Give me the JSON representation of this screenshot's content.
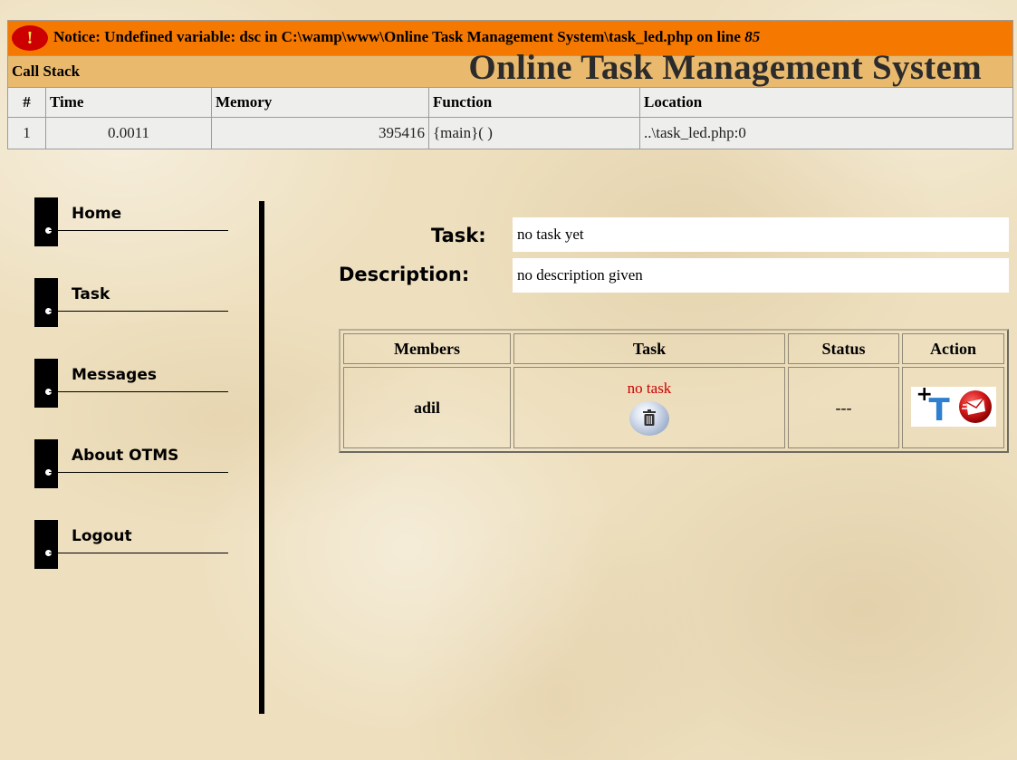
{
  "xdebug": {
    "notice_icon": "!",
    "notice_prefix": "Notice: Undefined variable: dsc in C:\\wamp\\www\\Online Task Management System\\task_led.php on line ",
    "notice_line": "85",
    "call_stack_label": "Call Stack",
    "columns": [
      "#",
      "Time",
      "Memory",
      "Function",
      "Location"
    ],
    "rows": [
      {
        "num": "1",
        "time": "0.0011",
        "memory": "395416",
        "function": "{main}( )",
        "location": "..\\task_led.php:0"
      }
    ],
    "colors": {
      "notice_bg": "#f57900",
      "callstack_bg": "#e9b96e",
      "table_bg": "#eeeeec"
    }
  },
  "site": {
    "title": "Online Task Management System"
  },
  "nav": {
    "items": [
      {
        "label": "Home"
      },
      {
        "label": "Task"
      },
      {
        "label": "Messages"
      },
      {
        "label": "About OTMS"
      },
      {
        "label": "Logout"
      }
    ]
  },
  "form": {
    "task_label": "Task:",
    "task_value": "no task yet",
    "description_label": "Description:",
    "description_value": "no description given"
  },
  "members_table": {
    "headers": [
      "Members",
      "Task",
      "Status",
      "Action"
    ],
    "rows": [
      {
        "member": "adil",
        "task": "no task",
        "status": "---",
        "task_color": "#cc0000"
      }
    ],
    "icons": {
      "delete": "trash-icon",
      "add_task": "add-task-icon",
      "message": "message-icon"
    }
  }
}
